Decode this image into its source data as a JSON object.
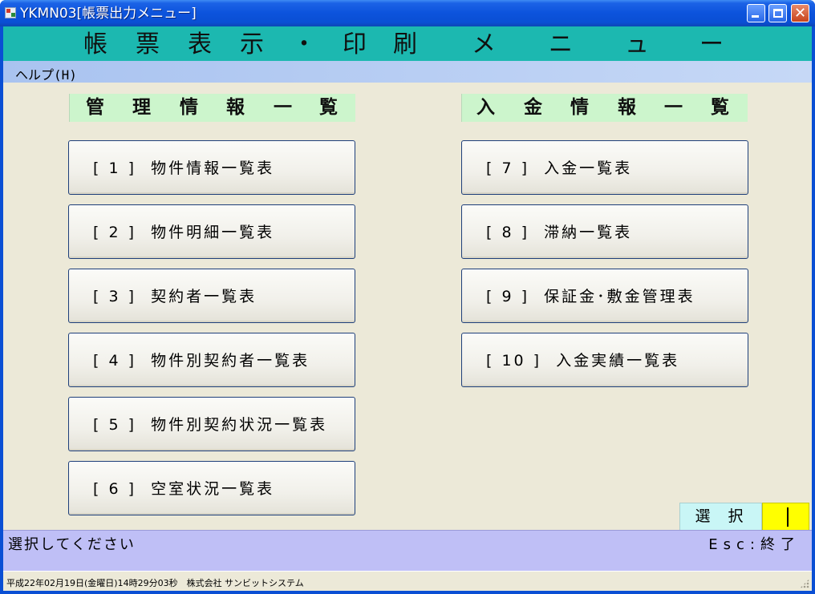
{
  "window": {
    "title": "YKMN03[帳票出力メニュー]",
    "icon": "app-icon"
  },
  "header": {
    "title_chars": [
      "帳",
      "票",
      "表",
      "示",
      "・",
      "印",
      "刷",
      "メ",
      "ニ",
      "ュ",
      "ー"
    ]
  },
  "menubar": {
    "help": "ヘルプ(H)"
  },
  "sections": {
    "left": {
      "chars": [
        "管",
        "理",
        "情",
        "報",
        "一",
        "覧"
      ]
    },
    "right": {
      "chars": [
        "入",
        "金",
        "情",
        "報",
        "一",
        "覧"
      ]
    }
  },
  "buttons": {
    "left": [
      "[ 1 ]  物件情報一覧表",
      "[ 2 ]  物件明細一覧表",
      "[ 3 ]  契約者一覧表",
      "[ 4 ]  物件別契約者一覧表",
      "[ 5 ]  物件別契約状況一覧表",
      "[ 6 ]  空室状況一覧表"
    ],
    "right": [
      "[ 7 ]  入金一覧表",
      "[ 8 ]  滞納一覧表",
      "[ 9 ]  保証金･敷金管理表",
      "[ 10 ]  入金実績一覧表"
    ]
  },
  "select": {
    "label": "選択",
    "value": ""
  },
  "status": {
    "message": "選択してください",
    "esc": "Esc:終了"
  },
  "footer": {
    "text": "平成22年02月19日(金曜日)14時29分03秒　株式会社 サンビットシステム"
  },
  "colors": {
    "header_bg": "#1cb8b0",
    "section_bg": "#ccf5cc",
    "select_input_bg": "#ffff00",
    "status_bg": "#bfbff6"
  }
}
